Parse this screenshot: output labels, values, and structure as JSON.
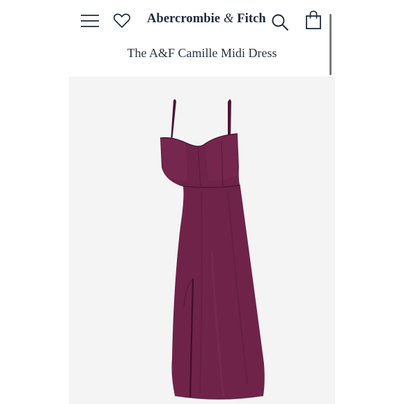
{
  "header": {
    "brand_name": "Abercrombie",
    "brand_amp": "&",
    "brand_suffix": "Fitch",
    "icons": [
      "menu-icon",
      "heart-icon",
      "search-icon",
      "bag-icon"
    ]
  },
  "product": {
    "title": "The A&F Camille Midi Dress",
    "image": "dress-image",
    "dress_color": "#6f2348"
  },
  "colors": {
    "brand_text": "#1f2a3d",
    "background": "#ffffff",
    "image_background": "#f4f4f4"
  }
}
